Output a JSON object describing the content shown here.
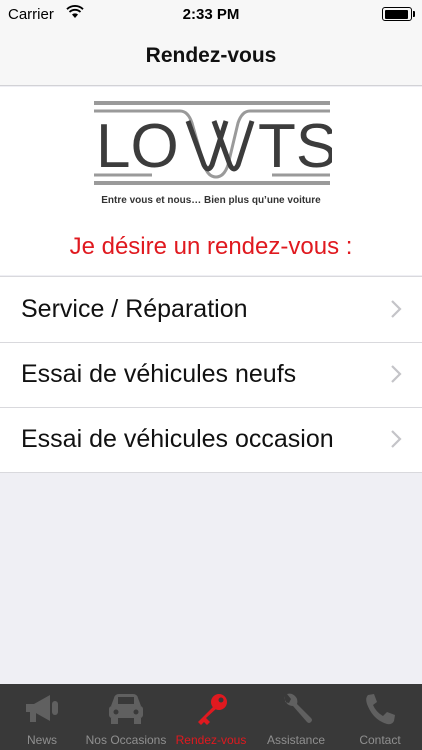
{
  "status_bar": {
    "carrier": "Carrier",
    "time": "2:33 PM"
  },
  "nav": {
    "title": "Rendez-vous"
  },
  "header": {
    "logo_text": "LOVATS",
    "tagline": "Entre vous et nous… Bien plus qu’une voiture",
    "prompt": "Je désire un rendez-vous :"
  },
  "menu": {
    "items": [
      {
        "label": "Service / Réparation"
      },
      {
        "label": "Essai de véhicules neufs"
      },
      {
        "label": "Essai de véhicules occasion"
      }
    ]
  },
  "tabs": [
    {
      "label": "News",
      "icon": "megaphone-icon"
    },
    {
      "label": "Nos Occasions",
      "icon": "car-icon"
    },
    {
      "label": "Rendez-vous",
      "icon": "key-icon",
      "active": true
    },
    {
      "label": "Assistance",
      "icon": "wrench-icon"
    },
    {
      "label": "Contact",
      "icon": "phone-icon"
    }
  ],
  "colors": {
    "accent": "#e0191f",
    "tab_bar": "#393939",
    "tab_inactive": "#909090"
  }
}
